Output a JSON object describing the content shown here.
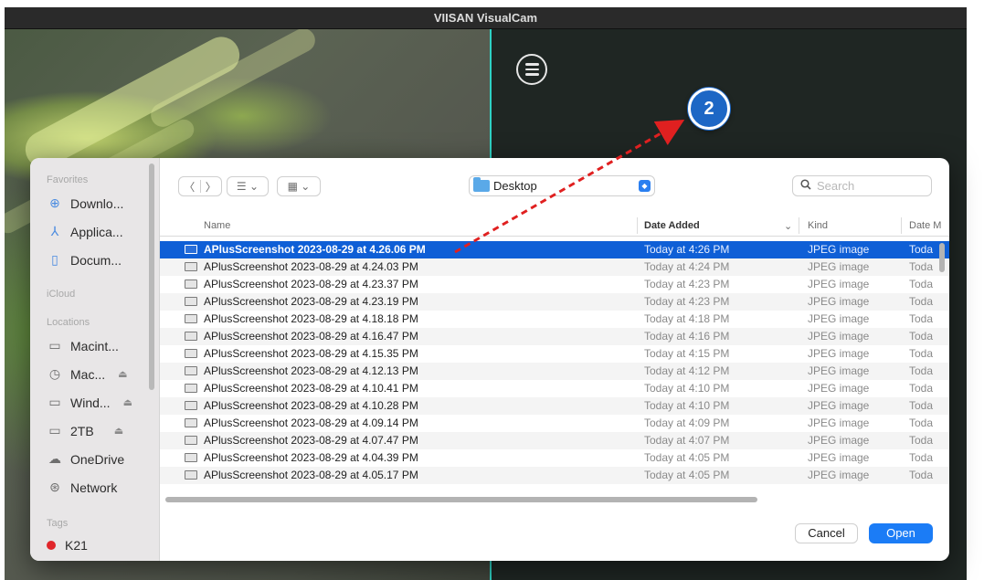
{
  "window": {
    "title": "VIISAN VisualCam"
  },
  "callout": {
    "label": "2"
  },
  "sidebar": {
    "favorites_heading": "Favorites",
    "icloud_heading": "iCloud",
    "locations_heading": "Locations",
    "tags_heading": "Tags",
    "favorites": [
      {
        "label": "Downlo...",
        "icon": "download-icon"
      },
      {
        "label": "Applica...",
        "icon": "applications-icon"
      },
      {
        "label": "Docum...",
        "icon": "document-icon"
      }
    ],
    "locations": [
      {
        "label": "Macint...",
        "icon": "drive-icon"
      },
      {
        "label": "Mac...",
        "icon": "time-machine-icon"
      },
      {
        "label": "Wind...",
        "icon": "drive-icon"
      },
      {
        "label": "2TB",
        "icon": "drive-icon"
      },
      {
        "label": "OneDrive",
        "icon": "cloud-icon"
      },
      {
        "label": "Network",
        "icon": "network-icon"
      }
    ],
    "tags": [
      {
        "label": "K21",
        "color": "#e0262b"
      }
    ]
  },
  "toolbar": {
    "back_glyph": "〈",
    "forward_glyph": "〉",
    "list_view_glyph": "☰ ⌄",
    "grid_view_glyph": "▦ ⌄",
    "location": "Desktop",
    "stepper_glyph": "◆",
    "search_placeholder": "Search"
  },
  "table": {
    "columns": {
      "name": "Name",
      "date_added": "Date Added",
      "kind": "Kind",
      "date_modified": "Date M"
    },
    "sort_glyph": "⌄",
    "rows": [
      {
        "name": "APlusScreenshot 2023-08-29 at 4.26.06 PM",
        "date_added": "Today at 4:26 PM",
        "kind": "JPEG image",
        "date_modified": "Toda",
        "selected": true
      },
      {
        "name": "APlusScreenshot 2023-08-29 at 4.24.03 PM",
        "date_added": "Today at 4:24 PM",
        "kind": "JPEG image",
        "date_modified": "Toda"
      },
      {
        "name": "APlusScreenshot 2023-08-29 at 4.23.37 PM",
        "date_added": "Today at 4:23 PM",
        "kind": "JPEG image",
        "date_modified": "Toda"
      },
      {
        "name": "APlusScreenshot 2023-08-29 at 4.23.19 PM",
        "date_added": "Today at 4:23 PM",
        "kind": "JPEG image",
        "date_modified": "Toda"
      },
      {
        "name": "APlusScreenshot 2023-08-29 at 4.18.18 PM",
        "date_added": "Today at 4:18 PM",
        "kind": "JPEG image",
        "date_modified": "Toda"
      },
      {
        "name": "APlusScreenshot 2023-08-29 at 4.16.47 PM",
        "date_added": "Today at 4:16 PM",
        "kind": "JPEG image",
        "date_modified": "Toda"
      },
      {
        "name": "APlusScreenshot 2023-08-29 at 4.15.35 PM",
        "date_added": "Today at 4:15 PM",
        "kind": "JPEG image",
        "date_modified": "Toda"
      },
      {
        "name": "APlusScreenshot 2023-08-29 at 4.12.13 PM",
        "date_added": "Today at 4:12 PM",
        "kind": "JPEG image",
        "date_modified": "Toda"
      },
      {
        "name": "APlusScreenshot 2023-08-29 at 4.10.41 PM",
        "date_added": "Today at 4:10 PM",
        "kind": "JPEG image",
        "date_modified": "Toda"
      },
      {
        "name": "APlusScreenshot 2023-08-29 at 4.10.28 PM",
        "date_added": "Today at 4:10 PM",
        "kind": "JPEG image",
        "date_modified": "Toda"
      },
      {
        "name": "APlusScreenshot 2023-08-29 at 4.09.14 PM",
        "date_added": "Today at 4:09 PM",
        "kind": "JPEG image",
        "date_modified": "Toda"
      },
      {
        "name": "APlusScreenshot 2023-08-29 at 4.07.47 PM",
        "date_added": "Today at 4:07 PM",
        "kind": "JPEG image",
        "date_modified": "Toda"
      },
      {
        "name": "APlusScreenshot 2023-08-29 at 4.04.39 PM",
        "date_added": "Today at 4:05 PM",
        "kind": "JPEG image",
        "date_modified": "Toda"
      },
      {
        "name": "APlusScreenshot 2023-08-29 at 4.05.17 PM",
        "date_added": "Today at 4:05 PM",
        "kind": "JPEG image",
        "date_modified": "Toda"
      }
    ]
  },
  "buttons": {
    "cancel": "Cancel",
    "open": "Open"
  },
  "colors": {
    "accent": "#1b7cf6",
    "selection": "#0f5fd6",
    "panel_border": "#2fd1c4",
    "callout": "#1d67c5",
    "arrow": "#e02020"
  }
}
